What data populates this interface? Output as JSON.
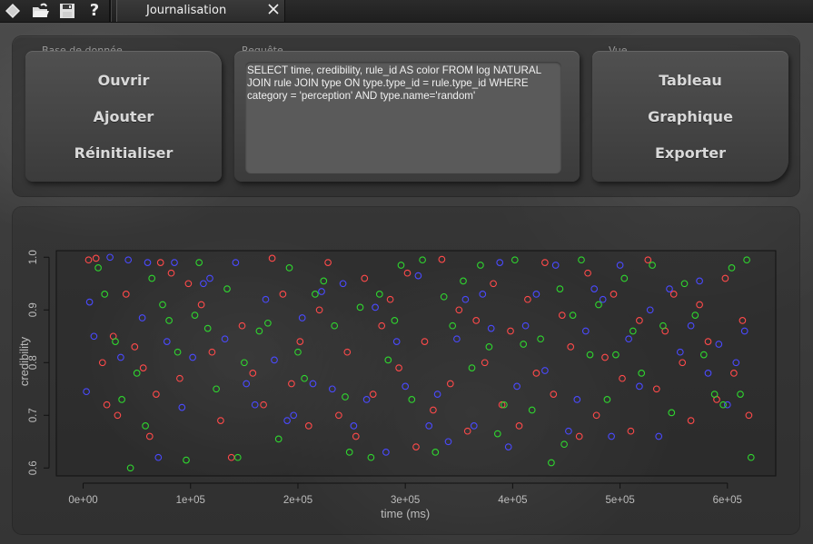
{
  "window": {
    "tab_title": "Journalisation"
  },
  "toolbar": {
    "icons": [
      "diamond-icon",
      "open-folder-icon",
      "save-icon",
      "help-icon"
    ],
    "help_glyph": "?"
  },
  "panels": {
    "database": {
      "label": "Base de donnée",
      "buttons": [
        "Ouvrir",
        "Ajouter",
        "Réinitialiser"
      ]
    },
    "query": {
      "label": "Requête",
      "text": "SELECT time, credibility, rule_id AS color FROM log NATURAL JOIN rule JOIN type ON type.type_id = rule.type_id WHERE category = 'perception' AND type.name='random'"
    },
    "view": {
      "label": "Vue",
      "buttons": [
        "Tableau",
        "Graphique",
        "Exporter"
      ]
    }
  },
  "chart_data": {
    "type": "scatter",
    "xlabel": "time (ms)",
    "ylabel": "credibility",
    "xlim": [
      -25000,
      645000
    ],
    "ylim": [
      0.585,
      1.0125
    ],
    "xticks": [
      0,
      100000,
      200000,
      300000,
      400000,
      500000,
      600000
    ],
    "xtick_labels": [
      "0e+00",
      "1e+05",
      "2e+05",
      "3e+05",
      "4e+05",
      "5e+05",
      "6e+05"
    ],
    "yticks": [
      0.6,
      0.7,
      0.8,
      0.9,
      1.0
    ],
    "ytick_labels": [
      "0.6",
      "0.7",
      "0.8",
      "0.9",
      "1.0"
    ],
    "series": [
      {
        "color": "#ff4a4a",
        "points": [
          [
            5000,
            0.995
          ],
          [
            12000,
            0.998
          ],
          [
            18000,
            0.8
          ],
          [
            22000,
            0.72
          ],
          [
            28000,
            0.85
          ],
          [
            32000,
            0.7
          ],
          [
            40000,
            0.93
          ],
          [
            48000,
            0.83
          ],
          [
            56000,
            0.79
          ],
          [
            62000,
            0.66
          ],
          [
            68000,
            0.74
          ],
          [
            72000,
            0.99
          ],
          [
            82000,
            0.97
          ],
          [
            90000,
            0.77
          ],
          [
            98000,
            0.95
          ],
          [
            110000,
            0.91
          ],
          [
            120000,
            0.82
          ],
          [
            128000,
            0.69
          ],
          [
            138000,
            0.62
          ],
          [
            148000,
            0.87
          ],
          [
            158000,
            0.78
          ],
          [
            168000,
            0.72
          ],
          [
            176000,
            0.998
          ],
          [
            186000,
            0.93
          ],
          [
            194000,
            0.76
          ],
          [
            202000,
            0.84
          ],
          [
            210000,
            0.68
          ],
          [
            220000,
            0.9
          ],
          [
            228000,
            0.99
          ],
          [
            238000,
            0.7
          ],
          [
            246000,
            0.82
          ],
          [
            254000,
            0.66
          ],
          [
            262000,
            0.96
          ],
          [
            270000,
            0.74
          ],
          [
            278000,
            0.87
          ],
          [
            286000,
            0.92
          ],
          [
            294000,
            0.79
          ],
          [
            302000,
            0.97
          ],
          [
            310000,
            0.64
          ],
          [
            318000,
            0.84
          ],
          [
            326000,
            0.71
          ],
          [
            334000,
            0.996
          ],
          [
            342000,
            0.76
          ],
          [
            350000,
            0.9
          ],
          [
            358000,
            0.67
          ],
          [
            366000,
            0.88
          ],
          [
            374000,
            0.8
          ],
          [
            382000,
            0.95
          ],
          [
            390000,
            0.72
          ],
          [
            398000,
            0.86
          ],
          [
            406000,
            0.68
          ],
          [
            414000,
            0.92
          ],
          [
            422000,
            0.78
          ],
          [
            430000,
            0.99
          ],
          [
            438000,
            0.74
          ],
          [
            446000,
            0.89
          ],
          [
            454000,
            0.83
          ],
          [
            462000,
            0.66
          ],
          [
            470000,
            0.97
          ],
          [
            478000,
            0.7
          ],
          [
            486000,
            0.81
          ],
          [
            494000,
            0.93
          ],
          [
            502000,
            0.77
          ],
          [
            510000,
            0.67
          ],
          [
            518000,
            0.88
          ],
          [
            526000,
            0.995
          ],
          [
            534000,
            0.75
          ],
          [
            542000,
            0.86
          ],
          [
            550000,
            0.93
          ],
          [
            558000,
            0.8
          ],
          [
            566000,
            0.69
          ],
          [
            574000,
            0.91
          ],
          [
            582000,
            0.84
          ],
          [
            590000,
            0.73
          ],
          [
            598000,
            0.96
          ],
          [
            606000,
            0.78
          ],
          [
            614000,
            0.88
          ],
          [
            620000,
            0.7
          ]
        ]
      },
      {
        "color": "#4a4aff",
        "points": [
          [
            3000,
            0.745
          ],
          [
            6000,
            0.915
          ],
          [
            10000,
            0.85
          ],
          [
            25000,
            1.0
          ],
          [
            35000,
            0.81
          ],
          [
            42000,
            0.995
          ],
          [
            55000,
            0.885
          ],
          [
            60000,
            0.99
          ],
          [
            70000,
            0.62
          ],
          [
            78000,
            0.84
          ],
          [
            85000,
            0.99
          ],
          [
            92000,
            0.715
          ],
          [
            102000,
            0.81
          ],
          [
            112000,
            0.95
          ],
          [
            118000,
            0.96
          ],
          [
            132000,
            0.845
          ],
          [
            142000,
            0.99
          ],
          [
            152000,
            0.76
          ],
          [
            160000,
            0.72
          ],
          [
            170000,
            0.92
          ],
          [
            178000,
            0.805
          ],
          [
            190000,
            0.69
          ],
          [
            196000,
            0.7
          ],
          [
            204000,
            0.885
          ],
          [
            214000,
            0.76
          ],
          [
            222000,
            0.935
          ],
          [
            232000,
            0.75
          ],
          [
            242000,
            0.95
          ],
          [
            252000,
            0.68
          ],
          [
            264000,
            0.73
          ],
          [
            272000,
            0.905
          ],
          [
            282000,
            0.63
          ],
          [
            292000,
            0.84
          ],
          [
            300000,
            0.755
          ],
          [
            312000,
            0.965
          ],
          [
            322000,
            0.68
          ],
          [
            330000,
            0.74
          ],
          [
            340000,
            0.65
          ],
          [
            348000,
            0.845
          ],
          [
            356000,
            0.92
          ],
          [
            364000,
            0.68
          ],
          [
            372000,
            0.93
          ],
          [
            380000,
            0.865
          ],
          [
            388000,
            0.99
          ],
          [
            396000,
            0.64
          ],
          [
            404000,
            0.755
          ],
          [
            412000,
            0.87
          ],
          [
            422000,
            0.93
          ],
          [
            430000,
            0.785
          ],
          [
            440000,
            0.985
          ],
          [
            452000,
            0.67
          ],
          [
            460000,
            0.73
          ],
          [
            468000,
            0.86
          ],
          [
            476000,
            0.94
          ],
          [
            484000,
            0.92
          ],
          [
            492000,
            0.66
          ],
          [
            500000,
            0.985
          ],
          [
            508000,
            0.845
          ],
          [
            518000,
            0.755
          ],
          [
            528000,
            0.9
          ],
          [
            536000,
            0.66
          ],
          [
            546000,
            0.94
          ],
          [
            556000,
            0.82
          ],
          [
            566000,
            0.87
          ],
          [
            574000,
            0.955
          ],
          [
            582000,
            0.78
          ],
          [
            592000,
            0.835
          ],
          [
            600000,
            0.72
          ],
          [
            608000,
            0.8
          ],
          [
            616000,
            0.86
          ]
        ]
      },
      {
        "color": "#2fd62f",
        "points": [
          [
            14000,
            0.98
          ],
          [
            20000,
            0.93
          ],
          [
            30000,
            0.84
          ],
          [
            36000,
            0.73
          ],
          [
            44000,
            0.6
          ],
          [
            50000,
            0.78
          ],
          [
            58000,
            0.68
          ],
          [
            64000,
            0.96
          ],
          [
            74000,
            0.91
          ],
          [
            80000,
            0.88
          ],
          [
            88000,
            0.82
          ],
          [
            96000,
            0.615
          ],
          [
            104000,
            0.89
          ],
          [
            108000,
            0.99
          ],
          [
            116000,
            0.865
          ],
          [
            124000,
            0.75
          ],
          [
            134000,
            0.94
          ],
          [
            144000,
            0.62
          ],
          [
            150000,
            0.8
          ],
          [
            164000,
            0.86
          ],
          [
            172000,
            0.875
          ],
          [
            182000,
            0.655
          ],
          [
            192000,
            0.98
          ],
          [
            200000,
            0.82
          ],
          [
            206000,
            0.77
          ],
          [
            216000,
            0.93
          ],
          [
            224000,
            0.955
          ],
          [
            234000,
            0.87
          ],
          [
            244000,
            0.735
          ],
          [
            248000,
            0.63
          ],
          [
            258000,
            0.905
          ],
          [
            268000,
            0.62
          ],
          [
            276000,
            0.93
          ],
          [
            284000,
            0.805
          ],
          [
            290000,
            0.88
          ],
          [
            296000,
            0.985
          ],
          [
            306000,
            0.73
          ],
          [
            316000,
            0.995
          ],
          [
            328000,
            0.63
          ],
          [
            336000,
            0.925
          ],
          [
            344000,
            0.87
          ],
          [
            354000,
            0.955
          ],
          [
            362000,
            0.79
          ],
          [
            370000,
            0.985
          ],
          [
            378000,
            0.83
          ],
          [
            386000,
            0.665
          ],
          [
            392000,
            0.72
          ],
          [
            402000,
            0.995
          ],
          [
            410000,
            0.835
          ],
          [
            418000,
            0.71
          ],
          [
            426000,
            0.845
          ],
          [
            436000,
            0.61
          ],
          [
            444000,
            0.94
          ],
          [
            448000,
            0.645
          ],
          [
            456000,
            0.89
          ],
          [
            464000,
            0.995
          ],
          [
            472000,
            0.815
          ],
          [
            480000,
            0.91
          ],
          [
            488000,
            0.73
          ],
          [
            496000,
            0.815
          ],
          [
            504000,
            0.96
          ],
          [
            512000,
            0.86
          ],
          [
            520000,
            0.78
          ],
          [
            530000,
            0.985
          ],
          [
            540000,
            0.87
          ],
          [
            548000,
            0.705
          ],
          [
            560000,
            0.95
          ],
          [
            570000,
            0.89
          ],
          [
            578000,
            0.815
          ],
          [
            588000,
            0.74
          ],
          [
            596000,
            0.72
          ],
          [
            604000,
            0.98
          ],
          [
            612000,
            0.74
          ],
          [
            618000,
            0.995
          ],
          [
            622000,
            0.62
          ]
        ]
      }
    ]
  }
}
